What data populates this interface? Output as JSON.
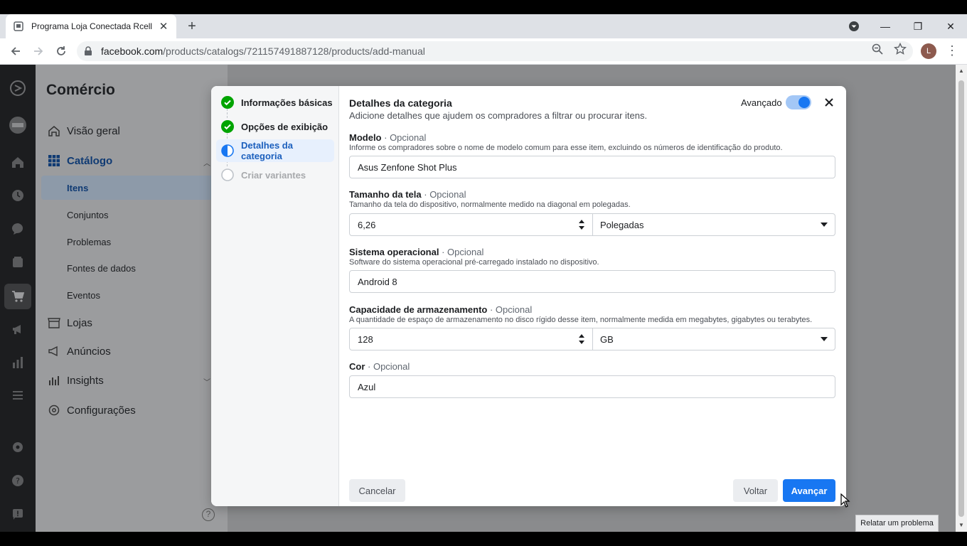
{
  "browser": {
    "tab_title": "Programa Loja Conectada Rcell",
    "url_host": "facebook.com",
    "url_path": "/products/catalogs/721157491887128/products/add-manual",
    "profile_initial": "L"
  },
  "sidebar": {
    "heading": "Comércio",
    "items": {
      "overview": "Visão geral",
      "catalog": "Catálogo",
      "stores": "Lojas",
      "ads": "Anúncios",
      "insights": "Insights",
      "settings": "Configurações"
    },
    "catalog_sub": {
      "items": "Itens",
      "sets": "Conjuntos",
      "issues": "Problemas",
      "data_sources": "Fontes de dados",
      "events": "Eventos"
    },
    "help_glyph": "?"
  },
  "report_button": "Relatar um problema",
  "modal": {
    "steps": {
      "basic": "Informações básicas",
      "display": "Opções de exibição",
      "category": "Detalhes da categoria",
      "variants": "Criar variantes"
    },
    "title": "Detalhes da categoria",
    "subtitle": "Adicione detalhes que ajudem os compradores a filtrar ou procurar itens.",
    "advanced_label": "Avançado",
    "advanced_on": true,
    "optional_suffix": "· Opcional",
    "model": {
      "label": "Modelo",
      "help": "Informe os compradores sobre o nome de modelo comum para esse item, excluindo os números de identificação do produto.",
      "value": "Asus Zenfone Shot Plus"
    },
    "screen": {
      "label": "Tamanho da tela",
      "help": "Tamanho da tela do dispositivo, normalmente medido na diagonal em polegadas.",
      "value": "6,26",
      "unit": "Polegadas"
    },
    "os": {
      "label": "Sistema operacional",
      "help": "Software do sistema operacional pré-carregado instalado no dispositivo.",
      "value": "Android 8"
    },
    "storage": {
      "label": "Capacidade de armazenamento",
      "help": "A quantidade de espaço de armazenamento no disco rígido desse item, normalmente medida em megabytes, gigabytes ou terabytes.",
      "value": "128",
      "unit": "GB"
    },
    "color": {
      "label": "Cor",
      "value": "Azul"
    },
    "buttons": {
      "cancel": "Cancelar",
      "back": "Voltar",
      "next": "Avançar"
    }
  },
  "colors": {
    "accent": "#1877f2",
    "success": "#00a400"
  }
}
